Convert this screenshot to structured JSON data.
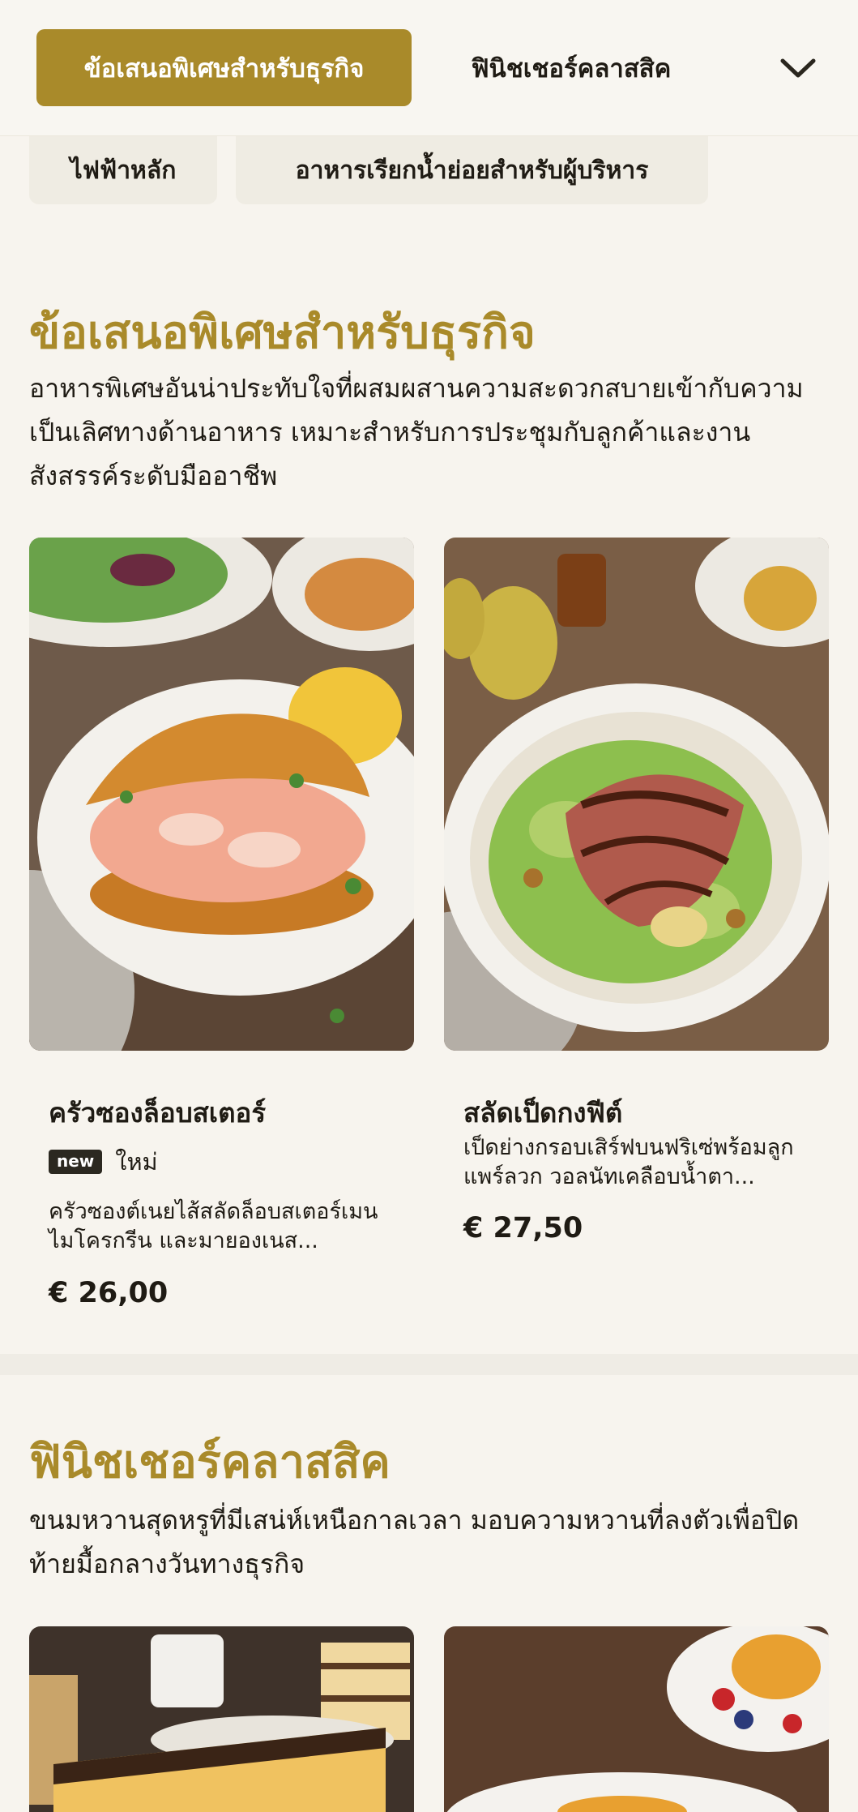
{
  "nav": {
    "active_tab": "ข้อเสนอพิเศษสำหรับธุรกิจ",
    "next_tab": "ฟินิชเชอร์คลาสสิค",
    "expand_icon": "chevron-down-icon"
  },
  "chips": [
    "ไฟฟ้าหลัก",
    "อาหารเรียกน้ำย่อยสำหรับผู้บริหาร"
  ],
  "sections": [
    {
      "title": "ข้อเสนอพิเศษสำหรับธุรกิจ",
      "description": "อาหารพิเศษอันน่าประทับใจที่ผสมผสานความสะดวกสบายเข้ากับความเป็นเลิศทางด้านอาหาร เหมาะสำหรับการประชุมกับลูกค้าและงานสังสรรค์ระดับมืออาชีพ",
      "items": [
        {
          "name": "ครัวซองล็อบสเตอร์",
          "badge": "new",
          "badge_label": "ใหม่",
          "description": "ครัวซองต์เนยไส้สลัดล็อบสเตอร์เมน ไมโครกรีน และมายองเนส...",
          "price": "€ 26,00"
        },
        {
          "name": "สลัดเป็ดกงฟีต์",
          "description": "เป็ดย่างกรอบเสิร์ฟบนฟริเซ่พร้อมลูกแพร์ลวก วอลนัทเคลือบน้ำตา...",
          "price": "€ 27,50"
        }
      ]
    },
    {
      "title": "ฟินิชเชอร์คลาสสิค",
      "description": "ขนมหวานสุดหรูที่มีเสน่ห์เหนือกาลเวลา มอบความหวานที่ลงตัวเพื่อปิดท้ายมื้อกลางวันทางธุรกิจ"
    }
  ],
  "colors": {
    "accent": "#a98a2a",
    "background": "#f7f4ee",
    "text": "#1f1b14"
  }
}
